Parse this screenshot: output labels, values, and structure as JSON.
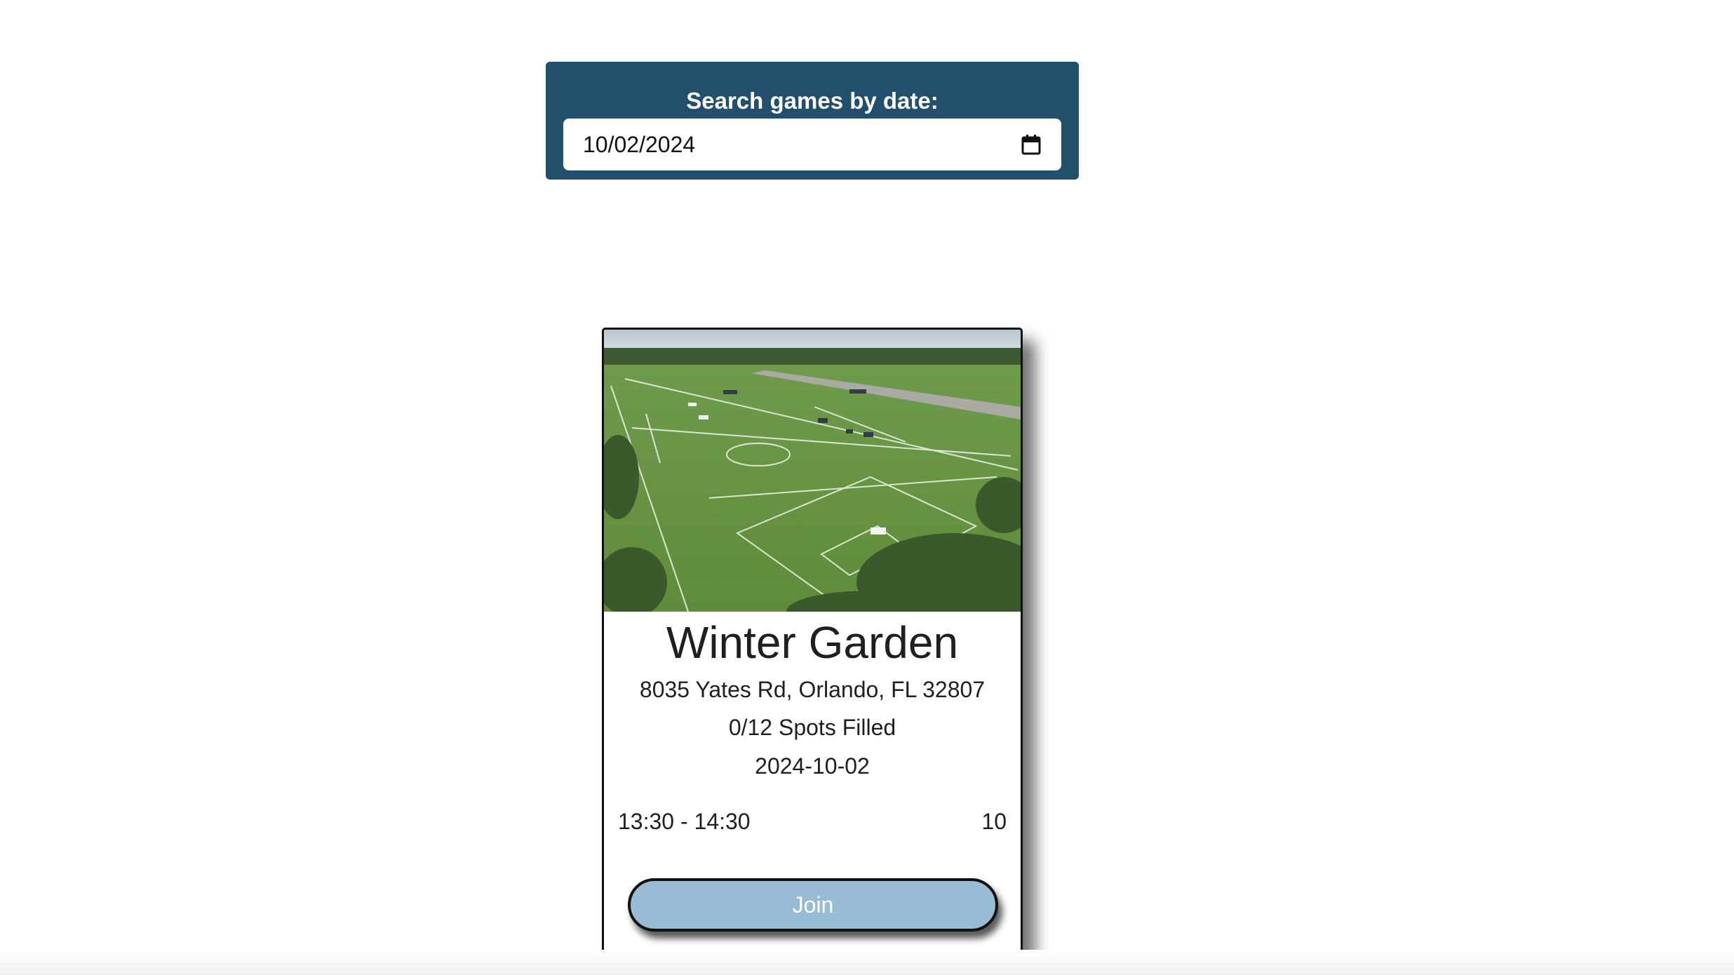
{
  "search": {
    "label": "Search games by date:",
    "date_value": "10/02/2024"
  },
  "game": {
    "venue": "Winter Garden",
    "address": "8035 Yates Rd, Orlando, FL 32807",
    "spots": "0/12 Spots Filled",
    "date": "2024-10-02",
    "time": "13:30 - 14:30",
    "count": "10",
    "join_label": "Join"
  },
  "colors": {
    "panel": "#224f6b",
    "join_button": "#98bcd6"
  }
}
